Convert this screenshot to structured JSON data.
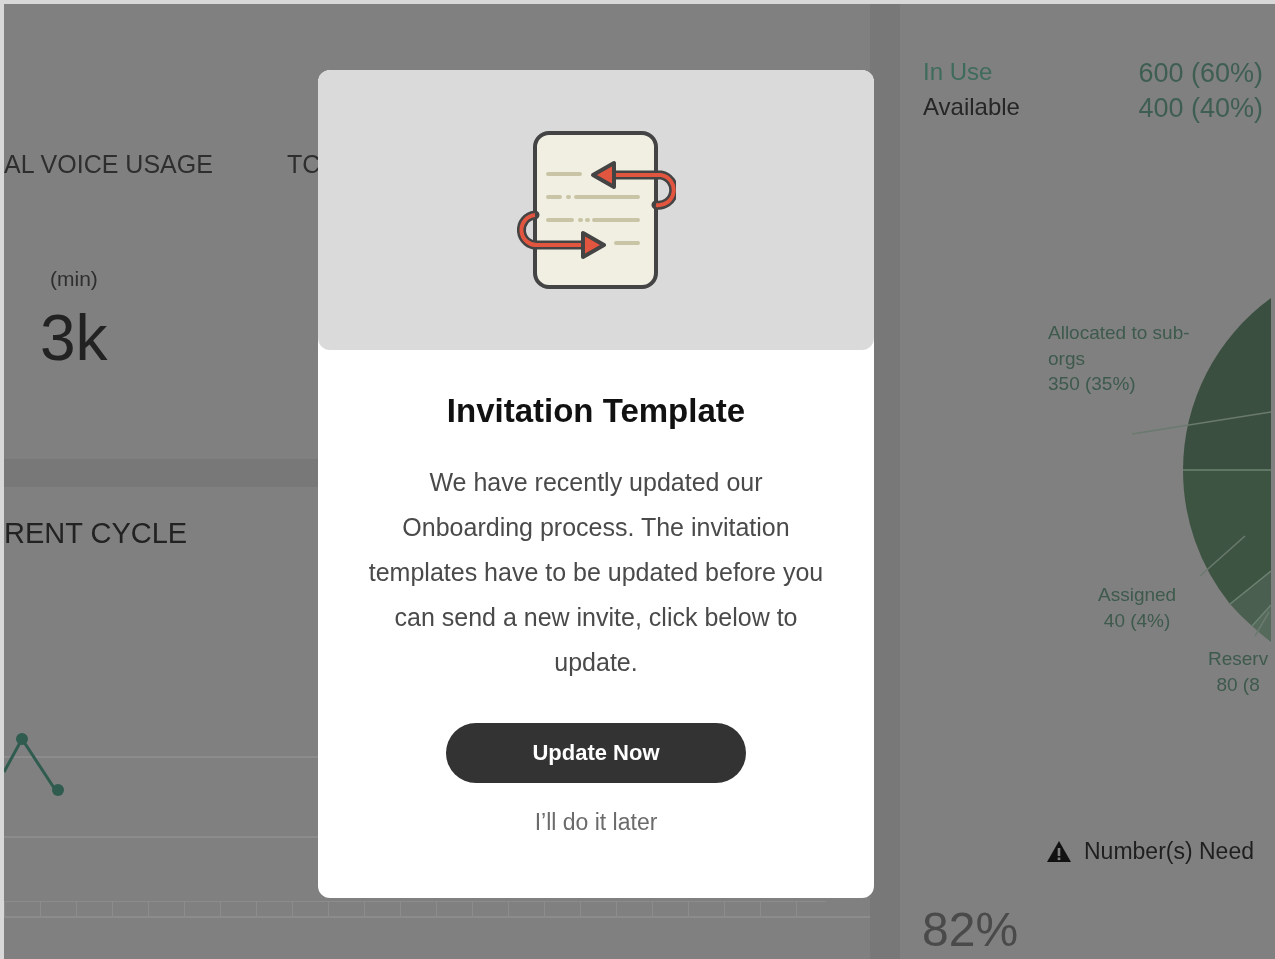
{
  "dashboard": {
    "left": {
      "tile_titles": [
        "AL VOICE USAGE",
        "TC"
      ],
      "unit": "(min)",
      "value": "3k",
      "section_title": "RENT CYCLE"
    },
    "right": {
      "legend": [
        {
          "label": "In Use",
          "value": "600 (60%)",
          "color": "#3e6b5b"
        },
        {
          "label": "Available",
          "value": "400 (40%)",
          "color": "#262626"
        }
      ],
      "pie_labels": [
        {
          "label": "Allocated to sub-orgs",
          "value": "350 (35%)"
        },
        {
          "label": "Assigned",
          "value": "40 (4%)"
        },
        {
          "label": "Reserv",
          "value": "80 (8"
        }
      ],
      "warning": "Number(s) Need",
      "percent": "82%"
    }
  },
  "modal": {
    "title": "Invitation Template",
    "message": "We have recently updated our Onboarding process. The invitation templates have to be updated before you can send a new invite, click below to update.",
    "primary_button": "Update Now",
    "secondary_link": "I’ll do it later"
  }
}
